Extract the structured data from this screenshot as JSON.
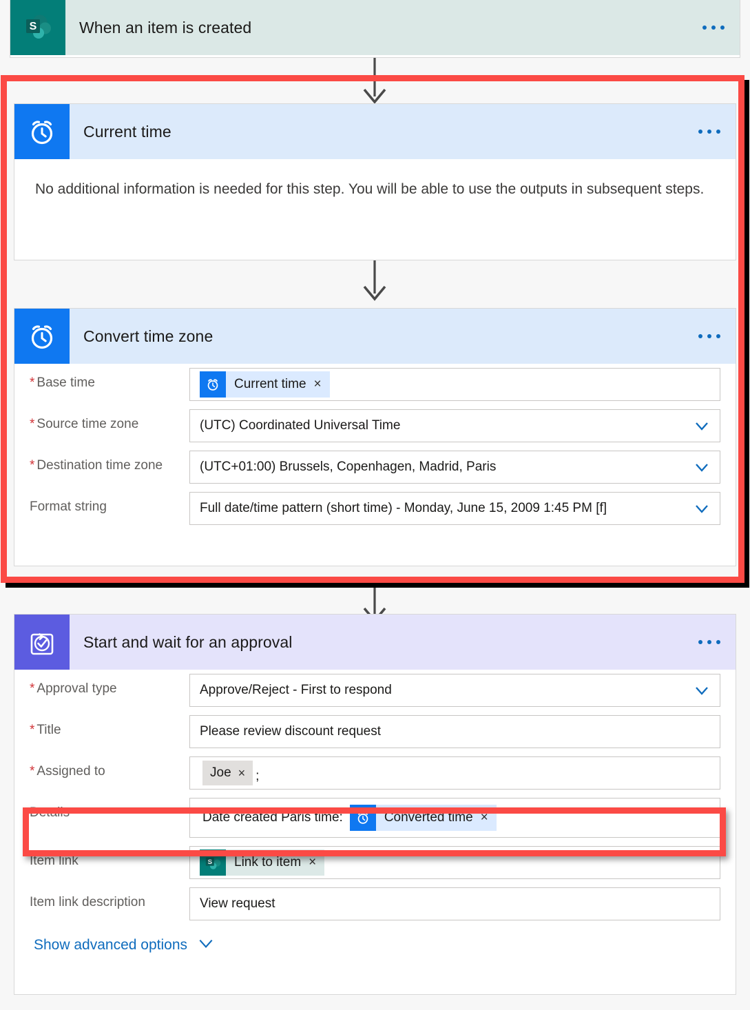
{
  "flow": {
    "steps": [
      {
        "id": "trigger",
        "title": "When an item is created",
        "icon": "sharepoint-icon",
        "header_bg": "#dbe8e6",
        "icon_bg": "#037e78",
        "menu": "...",
        "body_kind": "collapsed"
      },
      {
        "id": "current-time",
        "title": "Current time",
        "icon": "alarm-clock-icon",
        "header_bg": "#dceafb",
        "icon_bg": "#0f78f1",
        "menu": "...",
        "body_kind": "info",
        "info_text": "No additional information is needed for this step. You will be able to use the outputs in subsequent steps."
      },
      {
        "id": "convert-time-zone",
        "title": "Convert time zone",
        "icon": "alarm-clock-icon",
        "header_bg": "#dceafb",
        "icon_bg": "#0f78f1",
        "menu": "...",
        "body_kind": "fields",
        "fields": [
          {
            "label": "Base time",
            "required": true,
            "control": "token",
            "token": {
              "text": "Current time",
              "icon": "alarm-clock-icon",
              "style": "blue",
              "remove": "×"
            }
          },
          {
            "label": "Source time zone",
            "required": true,
            "control": "dropdown",
            "value": "(UTC) Coordinated Universal Time"
          },
          {
            "label": "Destination time zone",
            "required": true,
            "control": "dropdown",
            "value": "(UTC+01:00) Brussels, Copenhagen, Madrid, Paris"
          },
          {
            "label": "Format string",
            "required": false,
            "control": "dropdown",
            "value": "Full date/time pattern (short time) - Monday, June 15, 2009 1:45 PM [f]"
          }
        ]
      },
      {
        "id": "start-and-wait-approval",
        "title": "Start and wait for an approval",
        "icon": "approval-check-icon",
        "header_bg": "#e4e3fb",
        "icon_bg": "#5c5ce0",
        "menu": "...",
        "body_kind": "fields",
        "fields": [
          {
            "label": "Approval type",
            "required": true,
            "control": "dropdown",
            "value": "Approve/Reject - First to respond"
          },
          {
            "label": "Title",
            "required": true,
            "control": "text",
            "value": "Please review discount request"
          },
          {
            "label": "Assigned to",
            "required": true,
            "control": "person",
            "person": {
              "name": "Joe",
              "remove": "×"
            },
            "suffix": ";"
          },
          {
            "label": "Details",
            "required": false,
            "control": "text-plus-token",
            "prefix_text": "Date created Paris time:",
            "token": {
              "text": "Converted time",
              "icon": "alarm-clock-icon",
              "style": "blue",
              "remove": "×"
            }
          },
          {
            "label": "Item link",
            "required": false,
            "control": "token",
            "token": {
              "text": "Link to item",
              "icon": "sharepoint-icon",
              "style": "teal",
              "remove": "×"
            }
          },
          {
            "label": "Item link description",
            "required": false,
            "control": "text",
            "value": "View request"
          }
        ],
        "advanced_link": "Show advanced options"
      }
    ]
  },
  "annotations": {
    "highlight_steps_label": "time-steps-highlight",
    "highlight_details_label": "details-field-highlight",
    "color": "#fb4a45"
  }
}
